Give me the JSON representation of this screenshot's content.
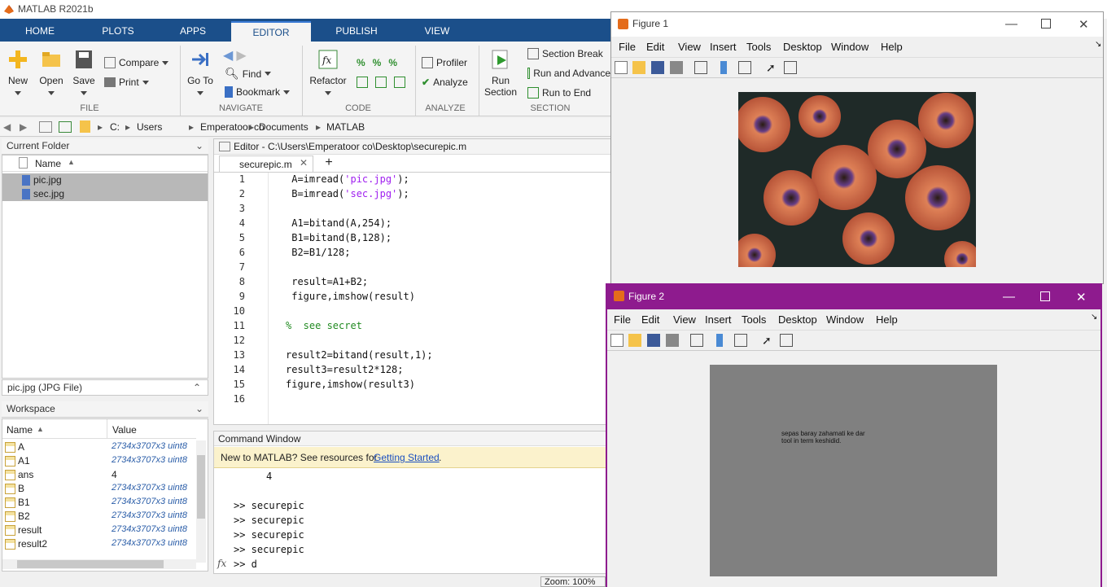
{
  "app": {
    "title": "MATLAB R2021b"
  },
  "tabs": [
    "HOME",
    "PLOTS",
    "APPS",
    "EDITOR",
    "PUBLISH",
    "VIEW"
  ],
  "ribbon": {
    "file": {
      "new": "New",
      "open": "Open",
      "save": "Save",
      "compare": "Compare",
      "print": "Print",
      "group": "FILE"
    },
    "navigate": {
      "goto_1": "Go To",
      "find": "Find",
      "bookmark": "Bookmark",
      "group": "NAVIGATE"
    },
    "code": {
      "refactor": "Refactor",
      "group": "CODE"
    },
    "analyze": {
      "profiler": "Profiler",
      "analyze": "Analyze",
      "group": "ANALYZE"
    },
    "section": {
      "run_1": "Run",
      "run_2": "Section",
      "section_break": "Section Break",
      "run_advance": "Run and Advance",
      "run_end": "Run to End",
      "group": "SECTION"
    }
  },
  "path": [
    "C:",
    "Users",
    "Emperatoor co",
    "Documents",
    "MATLAB"
  ],
  "folder": {
    "title": "Current Folder",
    "col_name": "Name",
    "files": [
      "pic.jpg",
      "sec.jpg"
    ],
    "details": "pic.jpg  (JPG File)"
  },
  "workspace": {
    "title": "Workspace",
    "col_name": "Name",
    "col_value": "Value",
    "vars": [
      {
        "name": "A",
        "value": "2734x3707x3 uint8"
      },
      {
        "name": "A1",
        "value": "2734x3707x3 uint8"
      },
      {
        "name": "ans",
        "value": "4"
      },
      {
        "name": "B",
        "value": "2734x3707x3 uint8"
      },
      {
        "name": "B1",
        "value": "2734x3707x3 uint8"
      },
      {
        "name": "B2",
        "value": "2734x3707x3 uint8"
      },
      {
        "name": "result",
        "value": "2734x3707x3 uint8"
      },
      {
        "name": "result2",
        "value": "2734x3707x3 uint8"
      }
    ]
  },
  "editor": {
    "title": "Editor - C:\\Users\\Emperatoor co\\Desktop\\securepic.m",
    "tab": "securepic.m",
    "lines": [
      {
        "n": "1",
        "pre": " A=imread(",
        "str": "'pic.jpg'",
        "post": ");"
      },
      {
        "n": "2",
        "pre": " B=imread(",
        "str": "'sec.jpg'",
        "post": ");"
      },
      {
        "n": "3",
        "pre": "",
        "str": "",
        "post": ""
      },
      {
        "n": "4",
        "pre": " A1=bitand(A,254);",
        "str": "",
        "post": ""
      },
      {
        "n": "5",
        "pre": " B1=bitand(B,128);",
        "str": "",
        "post": ""
      },
      {
        "n": "6",
        "pre": " B2=B1/128;",
        "str": "",
        "post": ""
      },
      {
        "n": "7",
        "pre": "",
        "str": "",
        "post": ""
      },
      {
        "n": "8",
        "pre": " result=A1+B2;",
        "str": "",
        "post": ""
      },
      {
        "n": "9",
        "pre": " figure,imshow(result)",
        "str": "",
        "post": ""
      },
      {
        "n": "10",
        "pre": "",
        "str": "",
        "post": ""
      },
      {
        "n": "11",
        "pre": "",
        "str": "",
        "post": "",
        "cmt": "%  see secret"
      },
      {
        "n": "12",
        "pre": "",
        "str": "",
        "post": ""
      },
      {
        "n": "13",
        "pre": "result2=bitand(result,1);",
        "str": "",
        "post": ""
      },
      {
        "n": "14",
        "pre": "result3=result2*128;",
        "str": "",
        "post": ""
      },
      {
        "n": "15",
        "pre": "figure,imshow(result3)",
        "str": "",
        "post": ""
      },
      {
        "n": "16",
        "pre": "",
        "str": "",
        "post": ""
      }
    ]
  },
  "cmd": {
    "title": "Command Window",
    "banner_text": "New to MATLAB? See resources for ",
    "banner_link": "Getting Started",
    "banner_end": ".",
    "output_value": "4",
    "history": [
      ">> securepic",
      ">> securepic",
      ">> securepic",
      ">> securepic"
    ],
    "prompt": ">> d",
    "fx": "fx"
  },
  "figure1": {
    "title": "Figure 1"
  },
  "figure2": {
    "title": "Figure 2",
    "secret_text_1": "sepas baray zahamati ke dar",
    "secret_text_2": "tool in term keshidid."
  },
  "figmenu": [
    "File",
    "Edit",
    "View",
    "Insert",
    "Tools",
    "Desktop",
    "Window",
    "Help"
  ],
  "zoom": "Zoom: 100%",
  "colors": {
    "tabbar": "#1b4f8a",
    "figure2_border": "#8e1b8e",
    "selected_row": "#b8b8b8"
  }
}
